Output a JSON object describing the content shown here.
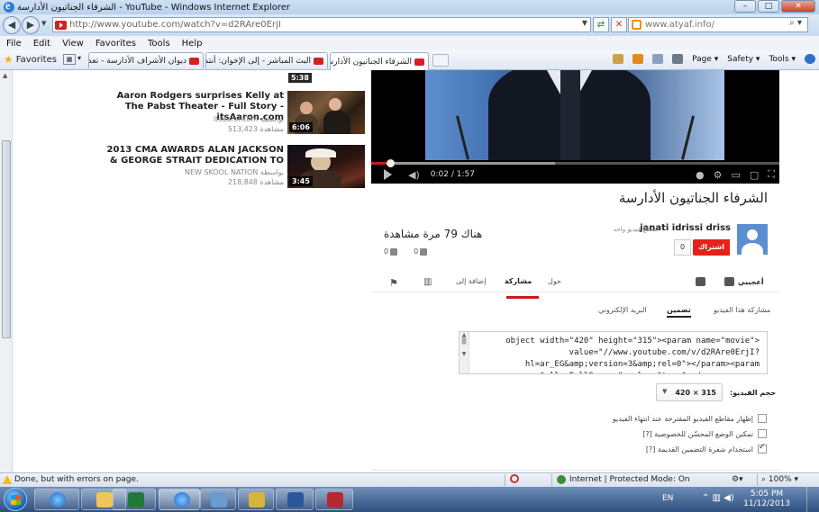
{
  "window": {
    "title": "الشرفاء الجناتيون الأدارسة - YouTube - Windows Internet Explorer",
    "min_label": "–",
    "max_label": "□",
    "close_label": "✕"
  },
  "address": {
    "url": "http://www.youtube.com/watch?v=d2RAre0ErjI",
    "search_provider": "www.atyaf.info/"
  },
  "menu": [
    "File",
    "Edit",
    "View",
    "Favorites",
    "Tools",
    "Help"
  ],
  "favorites": {
    "label": "Favorites"
  },
  "tabs": [
    {
      "label": "ديوان الأشراف الأدارسة - تعدى"
    },
    {
      "label": "البث المباشر - إلى الإخوان: أنتم"
    },
    {
      "label": "الشرفاء الجناتيون الأدارسة ..."
    }
  ],
  "command_bar": [
    "Page ▾",
    "Safety ▾",
    "Tools ▾"
  ],
  "suggested": [
    {
      "title": "Aaron Rodgers surprises Kelly at The Pabst Theater - Full Story - itsAaron.com",
      "channel": "itsaaroncom بواسطة",
      "views": "513,423 مشاهدة",
      "duration": "6:06",
      "top_duration": "5:38"
    },
    {
      "title": "2013 CMA AWARDS ALAN JACKSON & GEORGE STRAIT DEDICATION TO",
      "channel": "NEW SKOOL NATION بواسطة",
      "views": "218,848 مشاهدة",
      "duration": "3:45"
    }
  ],
  "player": {
    "current_time": "0:02",
    "separator": "/",
    "total_time": "1:57",
    "played_fraction": 0.02,
    "buffered_fraction": 0.45
  },
  "video": {
    "title": "الشرفاء الجناتيون الأدارسة",
    "channel": "janati idrissi driss",
    "channel_meta": "مقطع فيديو واحد",
    "subscribe_label": "اشتراك",
    "subscriber_count": "0",
    "views": "هناك 79 مرة مشاهدة",
    "likes": "0",
    "dislikes": "0"
  },
  "actions": {
    "like": "أعجبني",
    "about": "حول",
    "share": "مشاركة",
    "add_to": "إضافة إلى"
  },
  "share_tabs": {
    "share_video": "مشاركة هذا الفيديو",
    "embed": "تضمين",
    "email": "البريد الإلكتروني"
  },
  "embed_code": "object width=\"420\" height=\"315\"><param name=\"movie\">\nvalue=\"//www.youtube.com/v/d2RAre0ErjI?\nhl=ar_EG&amp;version=3&amp;rel=0\"></param><param\nname=\"allowFullScreen\" value=\"true\"></param><param",
  "video_size": {
    "label": "حجم الفيديو:",
    "value": "420 × 315"
  },
  "options": [
    {
      "label": "إظهار مقاطع الفيديو المقترحة عند انتهاء الفيديو",
      "checked": false
    },
    {
      "label": "تمكين الوضع المحسّن للخصوصية [?]",
      "checked": false
    },
    {
      "label": "استخدام شفرة التضمين القديمة [?]",
      "checked": true
    }
  ],
  "status": {
    "message": "Done, but with errors on page.",
    "zone": "Internet | Protected Mode: On",
    "zoom": "100%"
  },
  "taskbar": {
    "lang": "EN",
    "time": "5:05 PM",
    "date": "11/12/2013"
  },
  "colors": {
    "youtube_red": "#cc181e",
    "subscribe_red": "#e62117",
    "taskbar": "#2f4f7e"
  }
}
